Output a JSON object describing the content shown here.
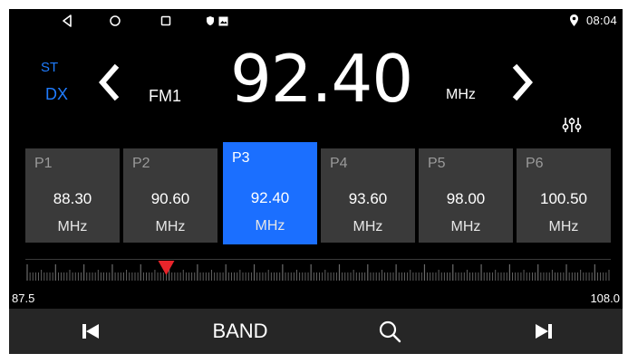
{
  "status": {
    "time": "08:04"
  },
  "tuner": {
    "stereo": "ST",
    "dx": "DX",
    "band": "FM1",
    "frequency": "92.40",
    "unit": "MHz"
  },
  "presets": [
    {
      "name": "P1",
      "freq": "88.30",
      "unit": "MHz",
      "active": false
    },
    {
      "name": "P2",
      "freq": "90.60",
      "unit": "MHz",
      "active": false
    },
    {
      "name": "P3",
      "freq": "92.40",
      "unit": "MHz",
      "active": true
    },
    {
      "name": "P4",
      "freq": "93.60",
      "unit": "MHz",
      "active": false
    },
    {
      "name": "P5",
      "freq": "98.00",
      "unit": "MHz",
      "active": false
    },
    {
      "name": "P6",
      "freq": "100.50",
      "unit": "MHz",
      "active": false
    }
  ],
  "scale": {
    "min": "87.5",
    "max": "108.0",
    "pointer_value": 92.4
  },
  "bottom": {
    "band_label": "BAND"
  },
  "colors": {
    "accent": "#1b6fff",
    "label_blue": "#1f7cff",
    "pointer": "#e8252b",
    "preset_bg": "#3a3a3a"
  }
}
